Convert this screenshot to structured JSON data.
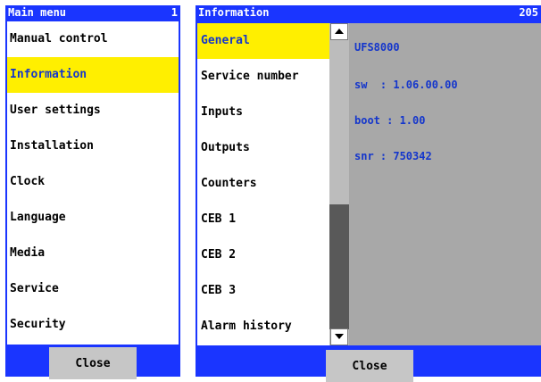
{
  "main_menu": {
    "title": "Main menu",
    "page": "1",
    "items": [
      {
        "label": "Manual control"
      },
      {
        "label": "Information"
      },
      {
        "label": "User settings"
      },
      {
        "label": "Installation"
      },
      {
        "label": "Clock"
      },
      {
        "label": "Language"
      },
      {
        "label": "Media"
      },
      {
        "label": "Service"
      },
      {
        "label": "Security"
      }
    ],
    "selected_index": 1,
    "close_label": "Close"
  },
  "info_panel": {
    "title": "Information",
    "page": "205",
    "items": [
      {
        "label": "General"
      },
      {
        "label": "Service number"
      },
      {
        "label": "Inputs"
      },
      {
        "label": "Outputs"
      },
      {
        "label": "Counters"
      },
      {
        "label": "CEB 1"
      },
      {
        "label": "CEB 2"
      },
      {
        "label": "CEB 3"
      },
      {
        "label": "Alarm history"
      }
    ],
    "selected_index": 0,
    "details": {
      "model": "UFS8000",
      "sw": "sw  : 1.06.00.00",
      "boot": "boot : 1.00",
      "snr": "snr : 750342"
    },
    "close_label": "Close"
  },
  "colors": {
    "panel_blue": "#1a35ff",
    "selection_yellow": "#ffef00",
    "detail_text_blue": "#1436cc",
    "detail_background": "#a8a8a8",
    "button_gray": "#c6c6c6"
  }
}
